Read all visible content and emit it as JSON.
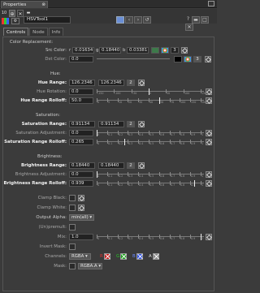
{
  "window": {
    "tab_title": "Properties",
    "tab_close": "⊗"
  },
  "node": {
    "name": "HSVTool1",
    "page_number": "10"
  },
  "tabs": [
    {
      "label": "Controls",
      "active": true
    },
    {
      "label": "Node",
      "active": false
    },
    {
      "label": "Info",
      "active": false
    }
  ],
  "sections": {
    "color_replacement": "Color Replacement:",
    "hue": "Hue:",
    "saturation": "Saturation:",
    "brightness": "Brightness:"
  },
  "src_color": {
    "label": "Src Color:",
    "r_lbl": "r",
    "r": "0.01634",
    "g_lbl": "g",
    "g": "0.18440",
    "b_lbl": "b",
    "b": "0.03381",
    "count": "3"
  },
  "dst_color": {
    "label": "Dst Color:",
    "value": "0.0",
    "count": "3"
  },
  "hue_range": {
    "label": "Hue Range:",
    "v1": "126.2346",
    "v2": "126.2346",
    "count": "2"
  },
  "hue_rotation": {
    "label": "Hue Rotation:",
    "value": "0.0",
    "ticks": [
      "-150",
      "-100",
      "-50",
      "0",
      "50",
      "100",
      "150"
    ]
  },
  "hue_rolloff": {
    "label": "Hue Range Rolloff:",
    "value": "50.0",
    "ticks": [
      "0",
      "5",
      "10",
      "20",
      "30",
      "40",
      "50",
      "70",
      "100",
      "150",
      "200"
    ]
  },
  "sat_range": {
    "label": "Saturation Range:",
    "v1": "0.91134",
    "v2": "0.91134",
    "count": "2"
  },
  "sat_adjust": {
    "label": "Saturation Adjustment:",
    "value": "0.0",
    "ticks": [
      "0",
      "0.1",
      "0.2",
      "0.3",
      "0.4",
      "0.5",
      "0.6",
      "0.7",
      "0.8",
      "0.9",
      "1"
    ]
  },
  "sat_rolloff": {
    "label": "Saturation Range Rolloff:",
    "value": "0.265",
    "ticks": [
      "0",
      "0.1",
      "0.2",
      "0.3",
      "0.4",
      "0.5",
      "0.6",
      "0.7",
      "0.8",
      "0.9",
      "1"
    ]
  },
  "bri_range": {
    "label": "Brightness Range:",
    "v1": "0.18440",
    "v2": "0.18440",
    "count": "2"
  },
  "bri_adjust": {
    "label": "Brightness Adjustment:",
    "value": "0.0",
    "ticks": [
      "0",
      "0.1",
      "0.2",
      "0.3",
      "0.4",
      "0.5",
      "0.6",
      "0.7",
      "0.8",
      "0.9",
      "1"
    ]
  },
  "bri_rolloff": {
    "label": "Brightness Range Rolloff:",
    "value": "0.939",
    "ticks": [
      "0",
      "0.1",
      "0.2",
      "0.3",
      "0.4",
      "0.5",
      "0.6",
      "0.7",
      "0.8",
      "0.9",
      "1"
    ]
  },
  "clamp_black": {
    "label": "Clamp Black:"
  },
  "clamp_white": {
    "label": "Clamp White:"
  },
  "output_alpha": {
    "label": "Output Alpha:",
    "value": "min(all) ▾"
  },
  "unpremult": {
    "label": "(Un)premult:"
  },
  "mix": {
    "label": "Mix:",
    "value": "1.0",
    "ticks": [
      "0",
      "0.1",
      "0.2",
      "0.3",
      "0.4",
      "0.5",
      "0.6",
      "0.7",
      "0.8",
      "0.9",
      "1"
    ]
  },
  "invert_mask": {
    "label": "Invert Mask:"
  },
  "channels": {
    "label": "Channels:",
    "value": "RGBA ▾",
    "r": "R",
    "g": "G",
    "b": "B",
    "a": "A"
  },
  "mask": {
    "label": "Mask:",
    "value": "RGBA.A ▾"
  },
  "colors": {
    "accent": "#6b8fd6",
    "red": "#e03030",
    "green": "#28c028",
    "blue": "#3a5cff"
  }
}
